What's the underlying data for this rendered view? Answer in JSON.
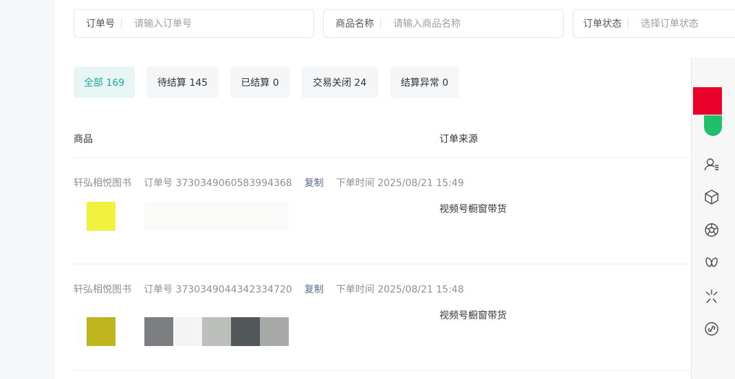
{
  "filters": [
    {
      "label": "订单号",
      "placeholder": "请输入订单号"
    },
    {
      "label": "商品名称",
      "placeholder": "请输入商品名称"
    },
    {
      "label": "订单状态",
      "placeholder": "选择订单状态"
    }
  ],
  "tabs": [
    "全部 169",
    "待结算 145",
    "已结算 0",
    "交易关闭 24",
    "结算异常 0"
  ],
  "columns": {
    "product": "商品",
    "source": "订单来源"
  },
  "orders": [
    {
      "shop": "轩弘相悦图书",
      "order_no": "订单号 3730349060583994368",
      "copy": "复制",
      "time": "下单时间 2025/08/21 15:49",
      "source": "视频号橱窗带货"
    },
    {
      "shop": "轩弘相悦图书",
      "order_no": "订单号 3730349044342334720",
      "copy": "复制",
      "time": "下单时间 2025/08/21 15:48",
      "source": "视频号橱窗带货"
    }
  ],
  "toolbar_icons": [
    "user-list-icon",
    "cube-icon",
    "aperture-icon",
    "butterfly-icon",
    "sparkle-icon",
    "link-icon"
  ],
  "colors": {
    "accent": "#1aab97",
    "copy_link": "#576b95",
    "toolbar_red": "#e8022a",
    "toolbar_green": "#1fbf6b"
  }
}
